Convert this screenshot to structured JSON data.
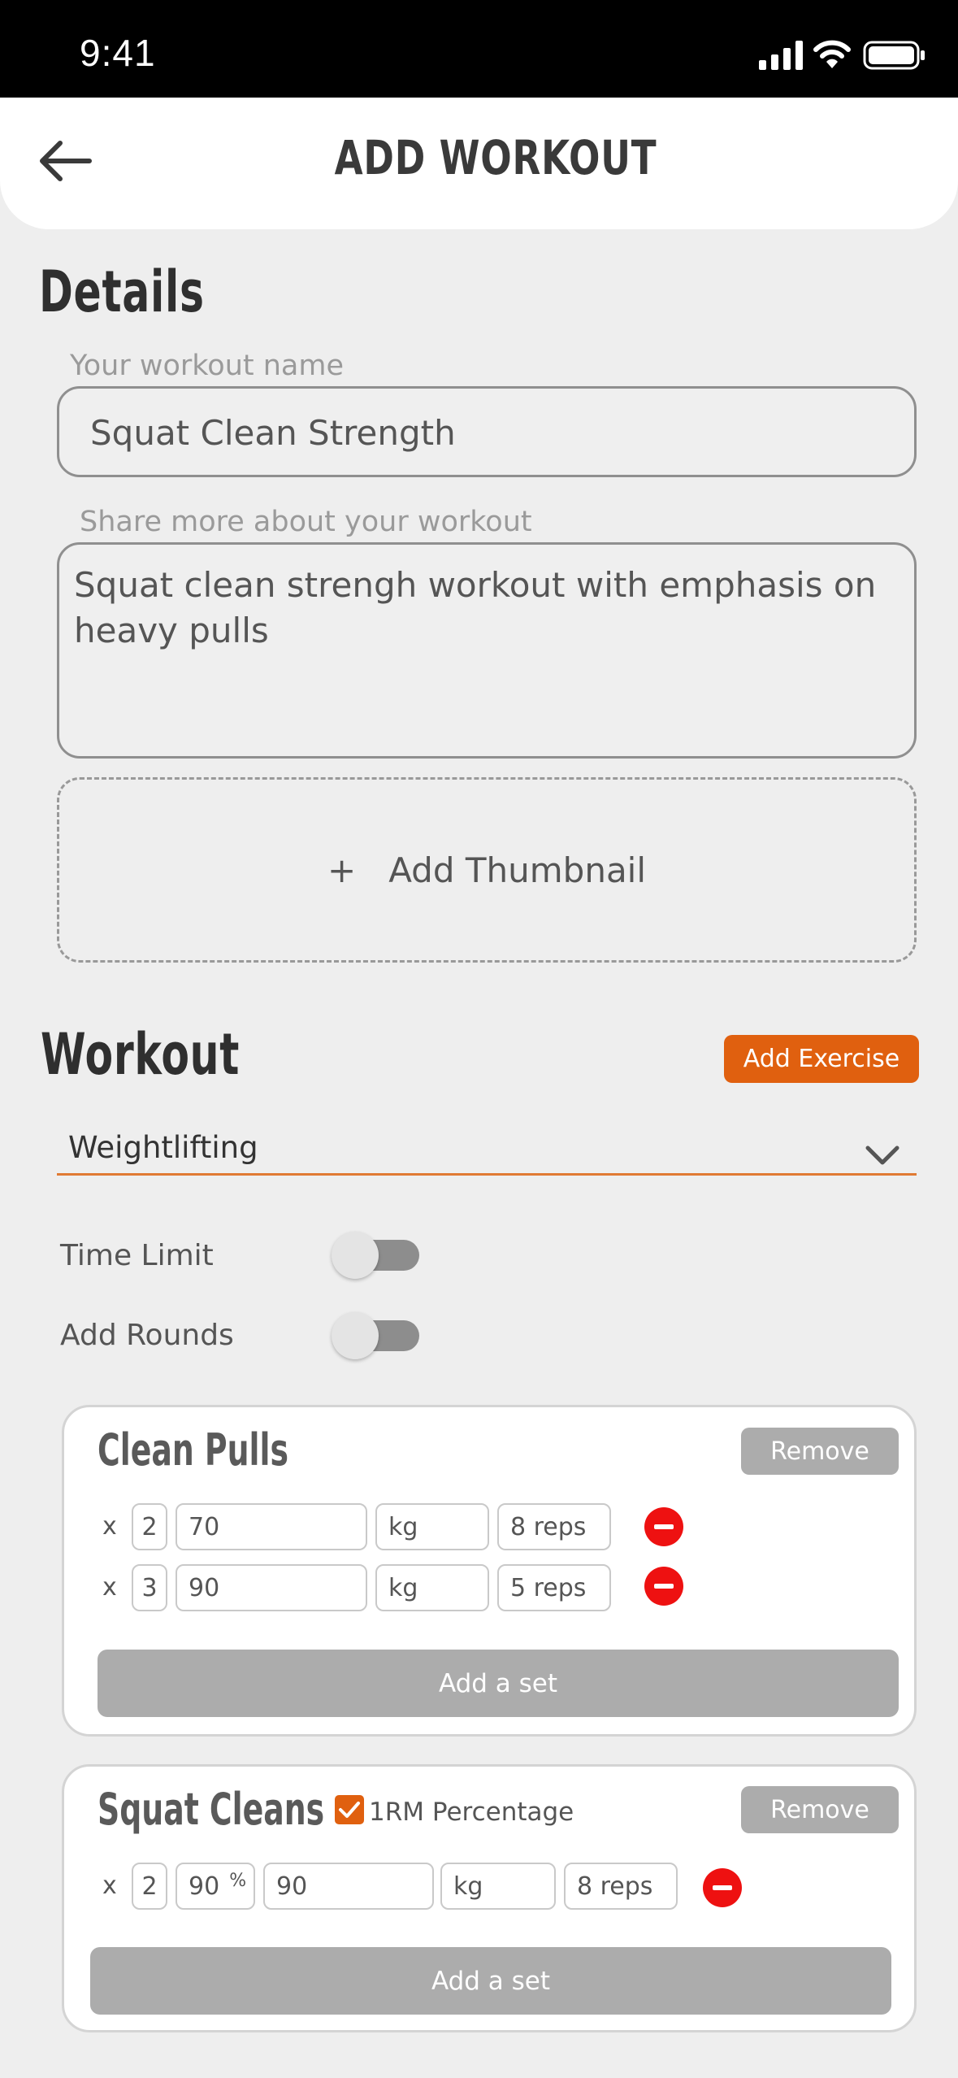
{
  "status_bar": {
    "time": "9:41"
  },
  "header": {
    "title": "ADD WORKOUT"
  },
  "details": {
    "section_title": "Details",
    "name_label": "Your workout name",
    "name_value": "Squat Clean Strength",
    "description_label": "Share more about your workout",
    "description_value": "Squat clean strengh workout with emphasis on heavy pulls",
    "thumbnail_label": "Add Thumbnail",
    "thumbnail_plus": "+"
  },
  "workout": {
    "section_title": "Workout",
    "add_exercise_label": "Add Exercise",
    "type_value": "Weightlifting",
    "time_limit_label": "Time Limit",
    "add_rounds_label": "Add Rounds",
    "time_limit_on": false,
    "add_rounds_on": false
  },
  "exercises": [
    {
      "name": "Clean Pulls",
      "remove_label": "Remove",
      "add_set_label": "Add a set",
      "sets": [
        {
          "x": "x",
          "count": "2",
          "weight": "70",
          "unit": "kg",
          "reps": "8 reps"
        },
        {
          "x": "x",
          "count": "3",
          "weight": "90",
          "unit": "kg",
          "reps": "5 reps"
        }
      ]
    },
    {
      "name": "Squat Cleans",
      "remove_label": "Remove",
      "add_set_label": "Add a set",
      "rm_label": "1RM Percentage",
      "rm_checked": true,
      "sets": [
        {
          "x": "x",
          "count": "2",
          "percent": "90",
          "percent_sign": "%",
          "weight": "90",
          "unit": "kg",
          "reps": "8 reps"
        }
      ]
    }
  ],
  "colors": {
    "accent": "#e0600f",
    "remove": "#ee1111",
    "button_gray": "#acacac"
  }
}
